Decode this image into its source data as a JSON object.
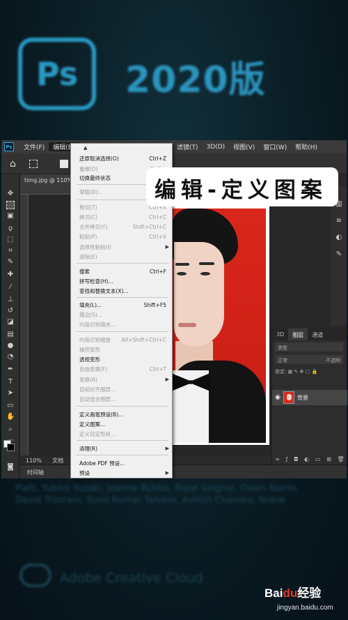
{
  "splash": {
    "logo_text": "Ps",
    "version_title": "2020版",
    "credits": "Piatt, Yukiko Yuzaki, Jeanne Rubbo, Rajat Singhal, Owen Norris, David Tristram, Sunil Kumar Tandon, Ashish Chandra, Noble",
    "cc_label": "Adobe Creative Cloud"
  },
  "watermark": {
    "brand_prefix": "Bai",
    "brand_paw": "du",
    "brand_suffix": "经验",
    "url": "jingyan.baidu.com"
  },
  "menubar": {
    "app_icon": "Ps",
    "items": [
      "文件(F)",
      "编辑(E)"
    ],
    "items_right": [
      "滤镜(T)",
      "3D(D)",
      "视图(V)",
      "窗口(W)",
      "帮助(H)"
    ]
  },
  "document": {
    "tab_title": "timg.jpg @ 110%",
    "zoom": "110%",
    "status_label": "文档",
    "timeline_label": "时间轴"
  },
  "edit_menu": {
    "items": [
      {
        "label": "还原取消选择(O)",
        "shortcut": "Ctrl+Z",
        "disabled": false
      },
      {
        "label": "重做(O)",
        "shortcut": "Shift+",
        "disabled": true
      },
      {
        "label": "切换最终状态",
        "shortcut": "Alt+",
        "disabled": false
      },
      {
        "label": "渐隐(D)...",
        "shortcut": "Shift+",
        "disabled": true
      },
      {
        "label": "剪切(T)",
        "shortcut": "Ctrl+X",
        "disabled": true
      },
      {
        "label": "拷贝(C)",
        "shortcut": "Ctrl+C",
        "disabled": true
      },
      {
        "label": "合并拷贝(Y)",
        "shortcut": "Shift+Ctrl+C",
        "disabled": true
      },
      {
        "label": "粘贴(P)",
        "shortcut": "Ctrl+V",
        "disabled": true
      },
      {
        "label": "选择性粘贴(I)",
        "shortcut": "",
        "disabled": true,
        "submenu": true
      },
      {
        "label": "清除(E)",
        "shortcut": "",
        "disabled": true
      },
      {
        "label": "搜索",
        "shortcut": "Ctrl+F",
        "disabled": false
      },
      {
        "label": "拼写检查(H)...",
        "shortcut": "",
        "disabled": false
      },
      {
        "label": "查找和替换文本(X)...",
        "shortcut": "",
        "disabled": false
      },
      {
        "label": "填充(L)...",
        "shortcut": "Shift+F5",
        "disabled": false
      },
      {
        "label": "描边(S)...",
        "shortcut": "",
        "disabled": true
      },
      {
        "label": "内容识别填充...",
        "shortcut": "",
        "disabled": true
      },
      {
        "label": "内容识别缩放",
        "shortcut": "Alt+Shift+Ctrl+C",
        "disabled": true
      },
      {
        "label": "操控变形",
        "shortcut": "",
        "disabled": true
      },
      {
        "label": "透视变形",
        "shortcut": "",
        "disabled": false
      },
      {
        "label": "自由变换(F)",
        "shortcut": "Ctrl+T",
        "disabled": true
      },
      {
        "label": "变换(A)",
        "shortcut": "",
        "disabled": true,
        "submenu": true
      },
      {
        "label": "自动对齐图层...",
        "shortcut": "",
        "disabled": true
      },
      {
        "label": "自动混合图层...",
        "shortcut": "",
        "disabled": true
      },
      {
        "label": "定义画笔预设(B)...",
        "shortcut": "",
        "disabled": false
      },
      {
        "label": "定义图案...",
        "shortcut": "",
        "disabled": false
      },
      {
        "label": "定义自定形状...",
        "shortcut": "",
        "disabled": true
      },
      {
        "label": "清理(R)",
        "shortcut": "",
        "disabled": false,
        "submenu": true
      },
      {
        "label": "Adobe PDF 预设...",
        "shortcut": "",
        "disabled": false
      },
      {
        "label": "预设",
        "shortcut": "",
        "disabled": false,
        "submenu": true
      }
    ]
  },
  "callout": {
    "title": "编辑-定义图案"
  },
  "layers_panel": {
    "tabs": [
      "3D",
      "图层",
      "通道"
    ],
    "kind_placeholder": "类型",
    "blend_mode": "正常",
    "opacity_label": "不透明",
    "lock_label": "锁定:",
    "layer_name": "背景"
  },
  "colors": {
    "accent": "#2fb1e0",
    "photo_background": "#d9261c",
    "menu_background": "#f0f0f0"
  }
}
